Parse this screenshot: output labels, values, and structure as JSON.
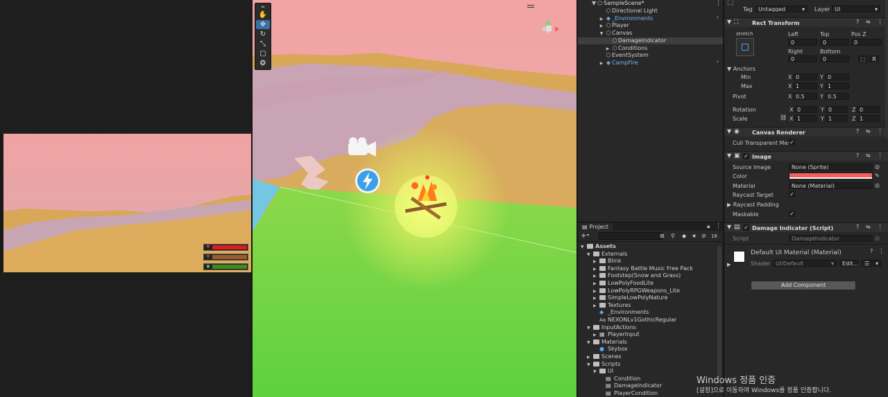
{
  "game_view": {
    "hud": [
      {
        "icon": "heart",
        "color": "#d81e1e",
        "fill": 1.0
      },
      {
        "icon": "hammer",
        "color": "#9b5c2a",
        "fill": 1.0
      },
      {
        "icon": "apple",
        "color": "#3f8a1f",
        "fill": 1.0
      }
    ]
  },
  "scene_view": {
    "tools": [
      "hand",
      "move",
      "rotate",
      "scale",
      "rect",
      "transform"
    ],
    "active_tool": 1,
    "menu_glyph": "═"
  },
  "hierarchy": {
    "scene_name": "SampleScene*",
    "items": [
      {
        "label": "Directional Light",
        "depth": 1,
        "arrow": "",
        "icon": "cube",
        "color": "#d2d2d2"
      },
      {
        "label": "_Environments",
        "depth": 1,
        "arrow": "▶",
        "icon": "prefab",
        "color": "#7bb6f0"
      },
      {
        "label": "Player",
        "depth": 1,
        "arrow": "▶",
        "icon": "cube",
        "color": "#d2d2d2"
      },
      {
        "label": "Canvas",
        "depth": 1,
        "arrow": "▼",
        "icon": "cube",
        "color": "#d2d2d2"
      },
      {
        "label": "DamageIndicator",
        "depth": 2,
        "arrow": "",
        "icon": "cube",
        "color": "#d2d2d2",
        "selected": true
      },
      {
        "label": "Conditions",
        "depth": 2,
        "arrow": "▶",
        "icon": "cube",
        "color": "#d2d2d2"
      },
      {
        "label": "EventSystem",
        "depth": 1,
        "arrow": "",
        "icon": "cube",
        "color": "#d2d2d2"
      },
      {
        "label": "CampFire",
        "depth": 1,
        "arrow": "▶",
        "icon": "prefab",
        "color": "#7bb6f0"
      }
    ]
  },
  "project": {
    "tab_label": "Project",
    "count": "16",
    "items": [
      {
        "label": "Assets",
        "depth": 0,
        "arrow": "▼",
        "kind": "folder",
        "bold": true
      },
      {
        "label": "Externals",
        "depth": 1,
        "arrow": "▼",
        "kind": "folder"
      },
      {
        "label": "Blink",
        "depth": 2,
        "arrow": "▶",
        "kind": "folder"
      },
      {
        "label": "Fantasy Battle Music Free Pack",
        "depth": 2,
        "arrow": "▶",
        "kind": "folder"
      },
      {
        "label": "Footstep(Snow and Grass)",
        "depth": 2,
        "arrow": "▶",
        "kind": "folder"
      },
      {
        "label": "LowPolyFoodLite",
        "depth": 2,
        "arrow": "▶",
        "kind": "folder"
      },
      {
        "label": "LowPolyRPGWeapons_Lite",
        "depth": 2,
        "arrow": "▶",
        "kind": "folder"
      },
      {
        "label": "SimpleLowPolyNature",
        "depth": 2,
        "arrow": "▶",
        "kind": "folder"
      },
      {
        "label": "Textures",
        "depth": 2,
        "arrow": "▶",
        "kind": "folder"
      },
      {
        "label": "_Environments",
        "depth": 2,
        "arrow": "",
        "kind": "prefab"
      },
      {
        "label": "NEXONLv1GothicRegular",
        "depth": 2,
        "arrow": "",
        "kind": "font"
      },
      {
        "label": "InputActions",
        "depth": 1,
        "arrow": "▼",
        "kind": "folder"
      },
      {
        "label": "PlayerInput",
        "depth": 2,
        "arrow": "▶",
        "kind": "input"
      },
      {
        "label": "Materials",
        "depth": 1,
        "arrow": "▼",
        "kind": "folder"
      },
      {
        "label": "Skybox",
        "depth": 2,
        "arrow": "",
        "kind": "material"
      },
      {
        "label": "Scenes",
        "depth": 1,
        "arrow": "▶",
        "kind": "folder"
      },
      {
        "label": "Scripts",
        "depth": 1,
        "arrow": "▼",
        "kind": "folder"
      },
      {
        "label": "UI",
        "depth": 2,
        "arrow": "▼",
        "kind": "folder"
      },
      {
        "label": "Condition",
        "depth": 3,
        "arrow": "",
        "kind": "script"
      },
      {
        "label": "DamageIndicator",
        "depth": 3,
        "arrow": "",
        "kind": "script"
      },
      {
        "label": "PlayerCondition",
        "depth": 3,
        "arrow": "",
        "kind": "script"
      }
    ]
  },
  "inspector": {
    "tag_label": "Tag",
    "tag_value": "Untagged",
    "layer_label": "Layer",
    "layer_value": "UI",
    "rect_transform": {
      "title": "Rect Transform",
      "stretch": "stretch",
      "left_label": "Left",
      "top_label": "Top",
      "posz_label": "Pos Z",
      "left": "0",
      "top": "0",
      "posz": "0",
      "right_label": "Right",
      "bottom_label": "Bottom",
      "right": "0",
      "bottom": "0",
      "anchors_label": "Anchors",
      "min_label": "Min",
      "max_label": "Max",
      "min_x": "0",
      "min_y": "0",
      "max_x": "1",
      "max_y": "1",
      "pivot_label": "Pivot",
      "pivot_x": "0.5",
      "pivot_y": "0.5",
      "rotation_label": "Rotation",
      "rot_x": "0",
      "rot_y": "0",
      "rot_z": "0",
      "scale_label": "Scale",
      "scale_x": "1",
      "scale_y": "1",
      "scale_z": "1",
      "x": "X",
      "y": "Y",
      "z": "Z",
      "blueprint_btn": "⬚",
      "raw_btn": "R"
    },
    "canvas_renderer": {
      "title": "Canvas Renderer",
      "cull_label": "Cull Transparent Mes"
    },
    "image": {
      "title": "Image",
      "source_image_label": "Source Image",
      "source_image": "None (Sprite)",
      "color_label": "Color",
      "color": "#f25f5c",
      "material_label": "Material",
      "material": "None (Material)",
      "raycast_target_label": "Raycast Target",
      "raycast_padding_label": "Raycast Padding",
      "maskable_label": "Maskable"
    },
    "damage_indicator": {
      "title": "Damage Indicator (Script)",
      "script_label": "Script",
      "script_value": "DamageIndicator"
    },
    "material": {
      "name": "Default UI Material (Material)",
      "shader_label": "Shader",
      "shader_value": "UI/Default",
      "edit_label": "Edit..."
    },
    "add_component": "Add Component"
  },
  "watermark": {
    "title": "Windows 정품 인증",
    "subtitle": "[설정]으로 이동하여 Windows를 정품 인증합니다."
  }
}
